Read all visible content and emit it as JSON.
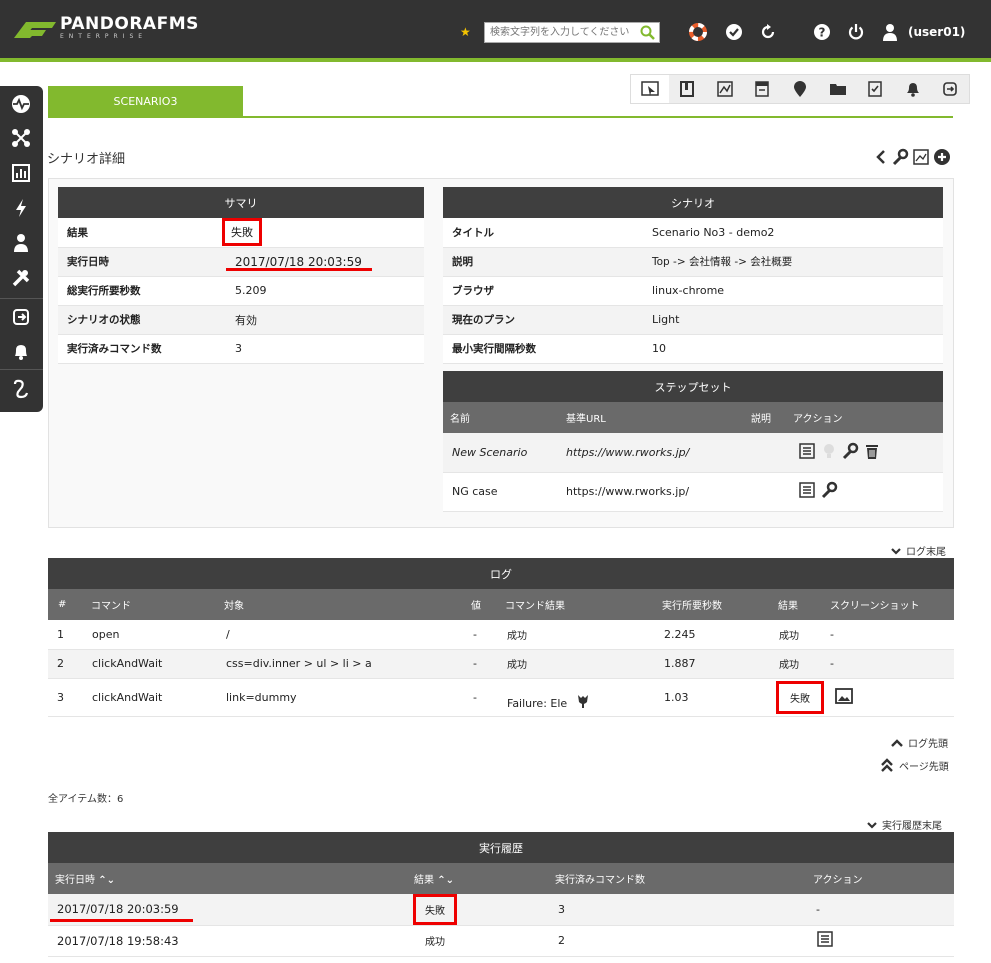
{
  "header": {
    "logo_text": "PANDORAFMS",
    "logo_sub": "ENTERPRISE",
    "search_placeholder": "検索文字列を入力してください",
    "user": "(user01)"
  },
  "tabs": {
    "active": "SCENARIO3"
  },
  "page": {
    "heading": "シナリオ詳細"
  },
  "summary": {
    "title": "サマリ",
    "rows": [
      {
        "label": "結果",
        "value": "失敗"
      },
      {
        "label": "実行日時",
        "value": "2017/07/18 20:03:59"
      },
      {
        "label": "総実行所要秒数",
        "value": "5.209"
      },
      {
        "label": "シナリオの状態",
        "value": "有効"
      },
      {
        "label": "実行済みコマンド数",
        "value": "3"
      }
    ]
  },
  "scenario": {
    "title": "シナリオ",
    "rows": [
      {
        "label": "タイトル",
        "value": "Scenario No3 - demo2"
      },
      {
        "label": "説明",
        "value": "Top -> 会社情報 -> 会社概要"
      },
      {
        "label": "ブラウザ",
        "value": "linux-chrome"
      },
      {
        "label": "現在のプラン",
        "value": "Light"
      },
      {
        "label": "最小実行間隔秒数",
        "value": "10"
      }
    ]
  },
  "stepset": {
    "title": "ステップセット",
    "columns": [
      "名前",
      "基準URL",
      "説明",
      "アクション"
    ],
    "rows": [
      {
        "name": "New Scenario",
        "url": "https://www.rworks.jp/",
        "desc": ""
      },
      {
        "name": "NG case",
        "url": "https://www.rworks.jp/",
        "desc": ""
      }
    ]
  },
  "log": {
    "link_end": "ログ末尾",
    "link_top": "ログ先頭",
    "page_top": "ページ先頭",
    "title": "ログ",
    "columns": [
      "#",
      "コマンド",
      "対象",
      "値",
      "コマンド結果",
      "実行所要秒数",
      "結果",
      "スクリーンショット"
    ],
    "rows": [
      {
        "n": "1",
        "cmd": "open",
        "target": "/",
        "value": "-",
        "cmd_result": "成功",
        "secs": "2.245",
        "result": "成功",
        "shot": "-"
      },
      {
        "n": "2",
        "cmd": "clickAndWait",
        "target": "css=div.inner > ul > li > a",
        "value": "-",
        "cmd_result": "成功",
        "secs": "1.887",
        "result": "成功",
        "shot": "-"
      },
      {
        "n": "3",
        "cmd": "clickAndWait",
        "target": "link=dummy",
        "value": "-",
        "cmd_result": "Failure: Ele",
        "secs": "1.03",
        "result": "失敗",
        "shot": ""
      }
    ]
  },
  "total_items": "全アイテム数：6",
  "history": {
    "link_end": "実行履歴末尾",
    "title": "実行履歴",
    "columns": [
      "実行日時",
      "結果",
      "実行済みコマンド数",
      "アクション"
    ],
    "rows": [
      {
        "date": "2017/07/18 20:03:59",
        "result": "失敗",
        "count": "3",
        "action": "-"
      },
      {
        "date": "2017/07/18 19:58:43",
        "result": "成功",
        "count": "2",
        "action": ""
      }
    ]
  },
  "colors": {
    "brand": "#82b92e",
    "dark": "#333333",
    "highlight": "#ee0000"
  }
}
